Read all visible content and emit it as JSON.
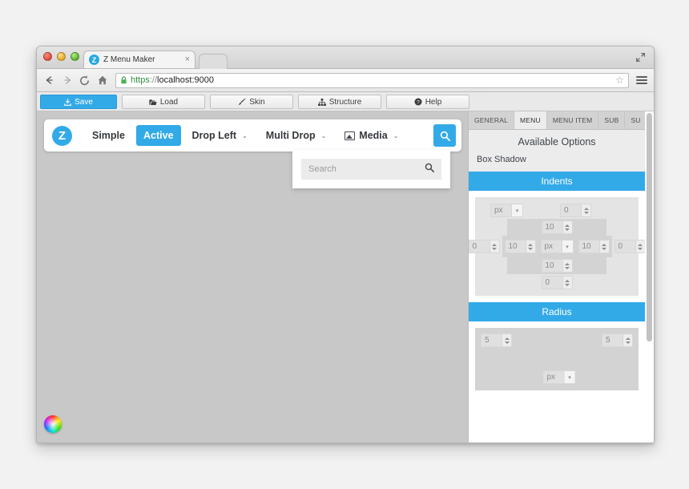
{
  "browser": {
    "tab": {
      "title": "Z Menu Maker",
      "favicon_letter": "Z",
      "close_label": "×"
    },
    "url": {
      "scheme": "https",
      "separator": "://",
      "host_port": "localhost:9000"
    },
    "icons": {
      "back": "back-arrow-icon",
      "forward": "forward-arrow-icon",
      "reload": "reload-icon",
      "home": "home-icon",
      "lock": "lock-icon",
      "star": "☆",
      "menu": "hamburger-menu-icon",
      "maximize": "maximize-icon"
    }
  },
  "toolbar": {
    "buttons": [
      {
        "label": "Save",
        "icon": "save-download-icon",
        "primary": true
      },
      {
        "label": "Load",
        "icon": "folder-open-icon",
        "primary": false
      },
      {
        "label": "Skin",
        "icon": "paintbrush-icon",
        "primary": false
      },
      {
        "label": "Structure",
        "icon": "sitemap-icon",
        "primary": false
      },
      {
        "label": "Help",
        "icon": "question-circle-icon",
        "primary": false
      }
    ]
  },
  "menubar": {
    "brand_letter": "Z",
    "items": [
      {
        "label": "Simple",
        "active": false,
        "dropdown": false,
        "icon": null
      },
      {
        "label": "Active",
        "active": true,
        "dropdown": false,
        "icon": null
      },
      {
        "label": "Drop Left",
        "active": false,
        "dropdown": true,
        "icon": null
      },
      {
        "label": "Multi Drop",
        "active": false,
        "dropdown": true,
        "icon": null
      },
      {
        "label": "Media",
        "active": false,
        "dropdown": true,
        "icon": "picture-icon"
      }
    ],
    "search_button_icon": "search-icon",
    "caret": "⌄"
  },
  "search_dropdown": {
    "placeholder": "Search",
    "icon": "search-icon"
  },
  "canvas": {
    "color_wheel": "color-wheel-icon"
  },
  "panel": {
    "tabs": [
      {
        "label": "GENERAL",
        "active": false
      },
      {
        "label": "MENU",
        "active": true
      },
      {
        "label": "MENU ITEM",
        "active": false
      },
      {
        "label": "SUB",
        "active": false
      },
      {
        "label": "SU",
        "active": false
      }
    ],
    "available_options_title": "Available Options",
    "options": [
      {
        "label": "Box Shadow"
      }
    ],
    "sections": [
      {
        "title": "Indents",
        "type": "indents",
        "margin": {
          "unit": "px",
          "top": "0",
          "right": "0",
          "bottom": "0",
          "left": "0"
        },
        "padding": {
          "unit": "px",
          "top": "10",
          "right": "10",
          "bottom": "10",
          "left": "10"
        }
      },
      {
        "title": "Radius",
        "type": "radius",
        "unit": "px",
        "top_left": "5",
        "top_right": "5"
      }
    ]
  },
  "colors": {
    "accent": "#33aae8",
    "panel_bg": "#ececec",
    "canvas_bg": "#c8c8c8",
    "page_bg": "#f2f2f2"
  }
}
